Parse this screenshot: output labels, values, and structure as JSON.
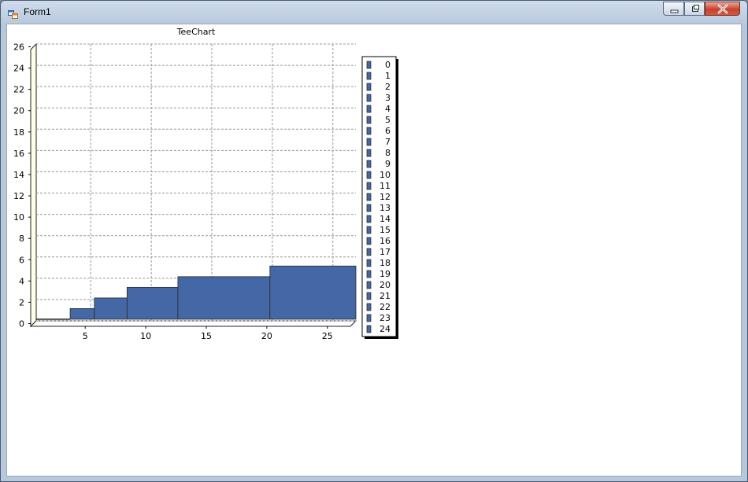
{
  "window": {
    "title": "Form1"
  },
  "icons": {
    "app": "form-window-icon",
    "minimize": "minimize-icon",
    "maximize": "maximize-icon",
    "close": "close-icon"
  },
  "colors": {
    "bar_fill": "#4467a5",
    "bar_edge": "#2a2a2a",
    "wall": "#ffffe8",
    "close_button": "#c8412c"
  },
  "chart_data": {
    "type": "bar",
    "title": "TeeChart",
    "bars": [
      {
        "x_start": 0.5,
        "x_end": 3.3,
        "value": 0
      },
      {
        "x_start": 3.3,
        "x_end": 5.3,
        "value": 1
      },
      {
        "x_start": 5.3,
        "x_end": 8.0,
        "value": 2
      },
      {
        "x_start": 8.0,
        "x_end": 12.2,
        "value": 3
      },
      {
        "x_start": 12.2,
        "x_end": 19.8,
        "value": 4
      },
      {
        "x_start": 19.8,
        "x_end": 26.9,
        "value": 5
      }
    ],
    "xlim": [
      0.5,
      26.9
    ],
    "ylim": [
      0,
      26
    ],
    "x_ticks": [
      5,
      10,
      15,
      20,
      25
    ],
    "y_ticks": [
      0,
      2,
      4,
      6,
      8,
      10,
      12,
      14,
      16,
      18,
      20,
      22,
      24,
      26
    ],
    "grid": true,
    "legend": {
      "placement": "right",
      "entries": [
        "0",
        "1",
        "2",
        "3",
        "4",
        "5",
        "6",
        "7",
        "8",
        "9",
        "10",
        "11",
        "12",
        "13",
        "14",
        "15",
        "16",
        "17",
        "18",
        "19",
        "20",
        "21",
        "22",
        "23",
        "24"
      ]
    }
  }
}
